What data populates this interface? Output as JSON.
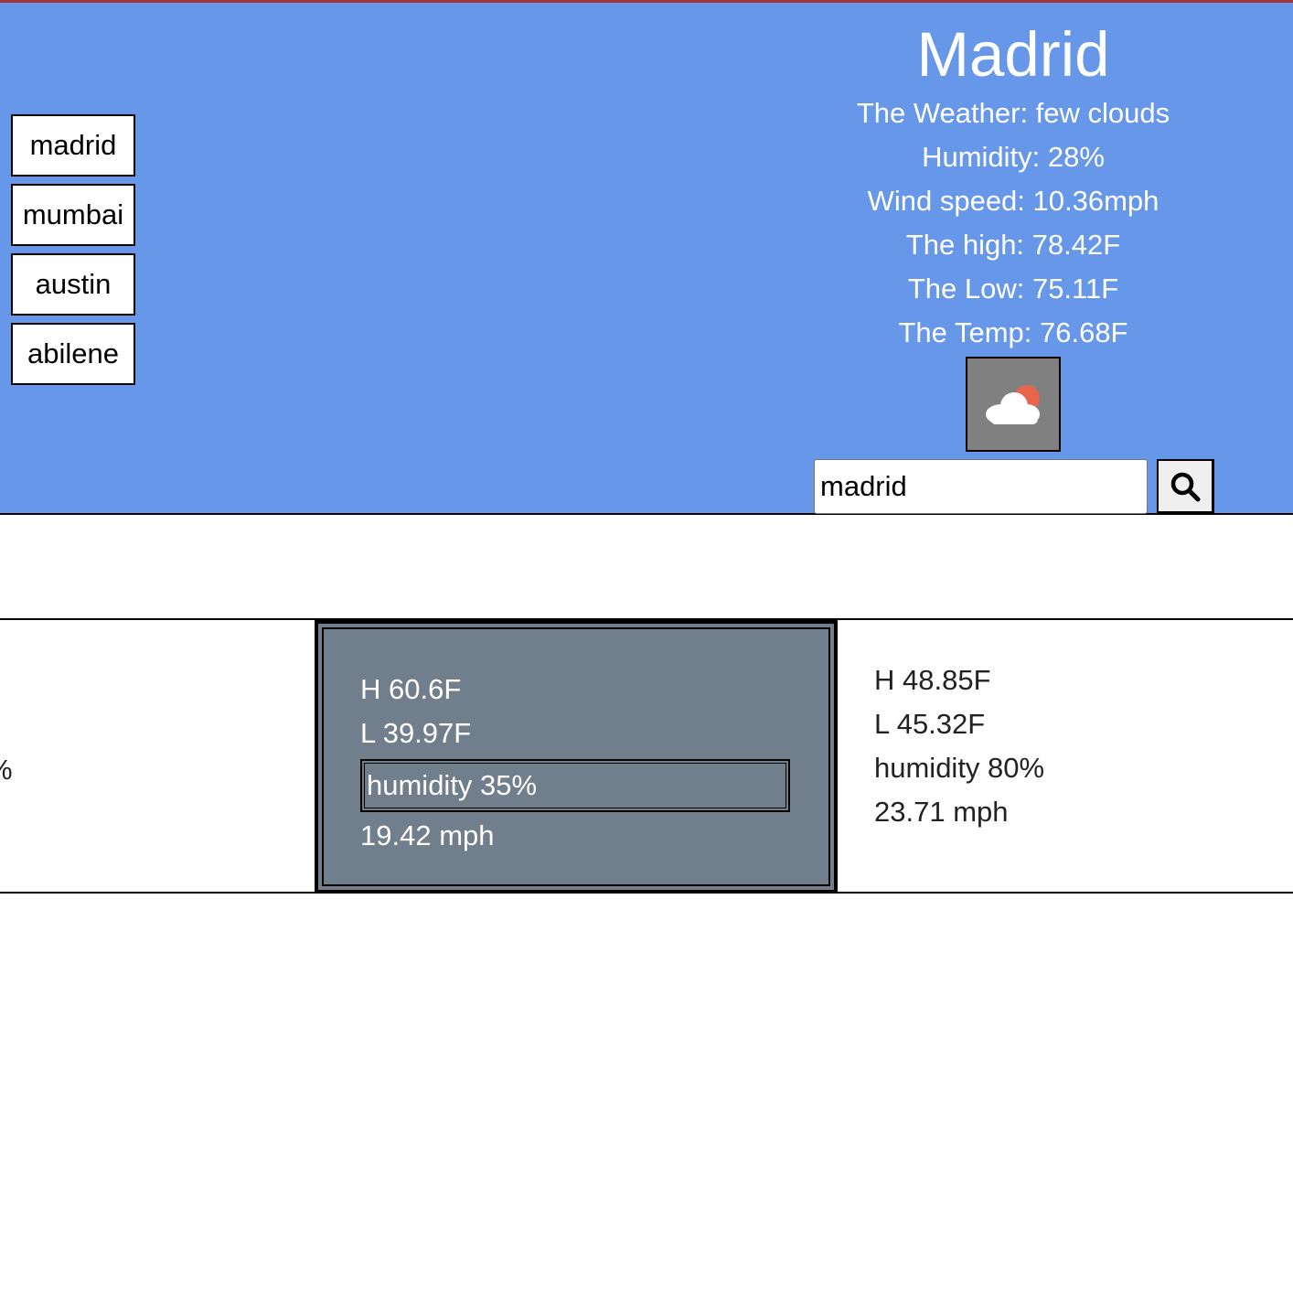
{
  "history": {
    "items": [
      {
        "label": "madrid"
      },
      {
        "label": "mumbai"
      },
      {
        "label": "austin"
      },
      {
        "label": "abilene"
      }
    ]
  },
  "current": {
    "city": "Madrid",
    "weather": "The Weather: few clouds",
    "humidity": "Humidity: 28%",
    "wind": "Wind speed: 10.36mph",
    "high": "The high: 78.42F",
    "low": "The Low: 75.11F",
    "temp": "The Temp: 76.68F",
    "icon": "few-clouds-icon"
  },
  "search": {
    "value": "madrid",
    "button_icon": "search-icon"
  },
  "forecast": {
    "left_partial": "%",
    "selected": {
      "high": "H 60.6F",
      "low": "L 39.97F",
      "humidity": "humidity 35%",
      "wind": "19.42 mph"
    },
    "right": {
      "high": "H 48.85F",
      "low": "L 45.32F",
      "humidity": "humidity 80%",
      "wind": "23.71 mph"
    }
  },
  "colors": {
    "header_bg": "#6797e8",
    "selected_day_bg": "#717f8d",
    "top_line": "#a4363a",
    "sun": "#e8644a"
  }
}
